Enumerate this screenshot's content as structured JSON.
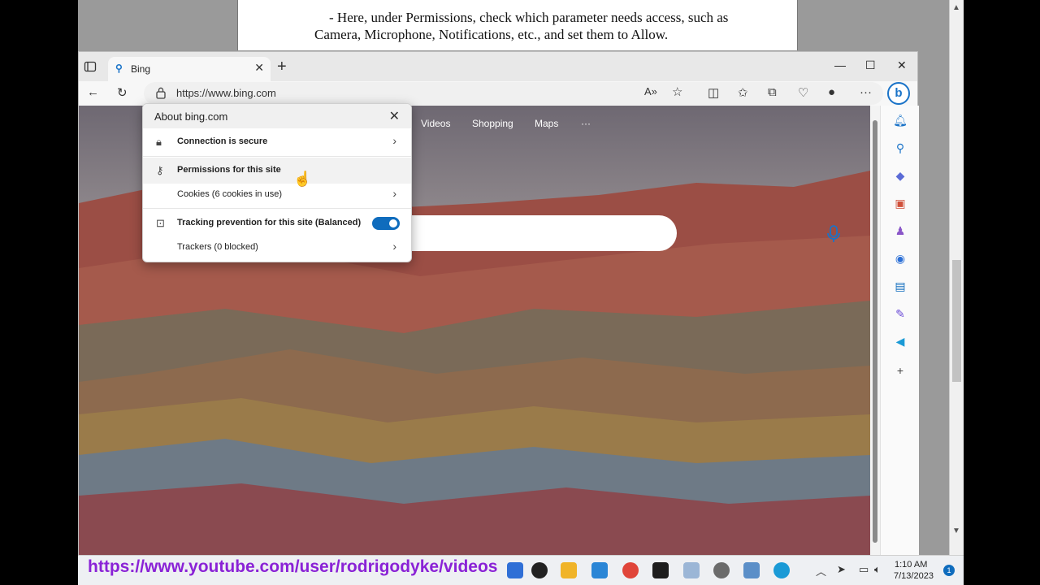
{
  "document": {
    "line1": "- Here, under Permissions, check which parameter needs access, such as",
    "line2": "Camera, Microphone, Notifications, etc., and set them to Allow."
  },
  "browser": {
    "tab_title": "Bing",
    "url": "https://www.bing.com",
    "controls": {
      "minimize": "—",
      "maximize": "☐",
      "close": "✕"
    },
    "new_tab": "+"
  },
  "bing_nav": [
    "Videos",
    "Shopping",
    "Maps",
    "···"
  ],
  "flyout": {
    "title": "About bing.com",
    "rows": [
      {
        "label": "Connection is secure",
        "icon": "lock-icon",
        "chevron": true,
        "bold": true
      },
      {
        "label": "Permissions for this site",
        "icon": "key-icon",
        "chevron": false,
        "bold": true,
        "hover": true
      },
      {
        "label": "Cookies (6 cookies in use)",
        "icon": "",
        "chevron": true,
        "bold": false
      },
      {
        "label": "Tracking prevention for this site (Balanced)",
        "icon": "tracking-icon",
        "toggle": true,
        "bold": true
      },
      {
        "label": "Trackers (0 blocked)",
        "icon": "",
        "chevron": true,
        "bold": false
      }
    ],
    "tracking_enabled": true
  },
  "taskbar": {
    "time": "1:10 AM",
    "date": "7/13/2023",
    "notifications": "1"
  },
  "watermark": "https://www.youtube.com/user/rodrigodyke/videos",
  "colors": {
    "accent": "#0f6cbd",
    "watermark": "#8a22d6"
  }
}
